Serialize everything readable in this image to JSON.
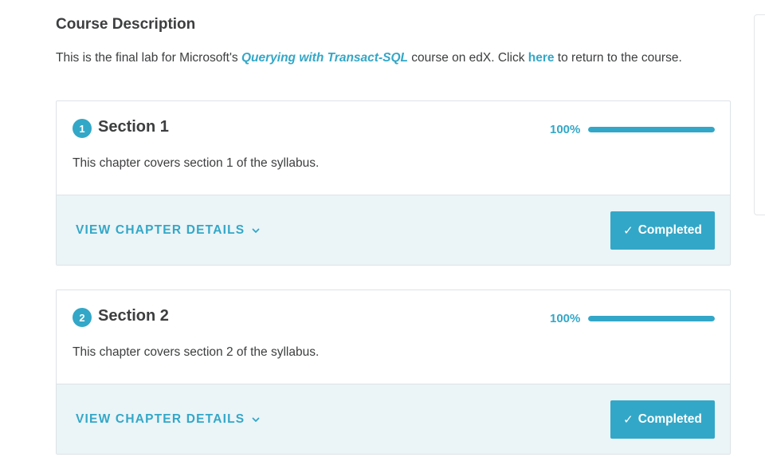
{
  "description": {
    "title": "Course Description",
    "text_before": "This is the final lab for Microsoft's ",
    "course_link": "Querying with Transact-SQL",
    "text_middle": " course on edX. Click ",
    "here_link": "here",
    "text_after": " to return to the course."
  },
  "sections": [
    {
      "number": "1",
      "title": "Section 1",
      "progress_label": "100%",
      "progress": 1.0,
      "description": "This chapter covers section 1 of the syllabus.",
      "details_label": "VIEW CHAPTER DETAILS",
      "status_label": "Completed",
      "status_icon": "✓"
    },
    {
      "number": "2",
      "title": "Section 2",
      "progress_label": "100%",
      "progress": 1.0,
      "description": "This chapter covers section 2 of the syllabus.",
      "details_label": "VIEW CHAPTER DETAILS",
      "status_label": "Completed",
      "status_icon": "✓"
    }
  ],
  "colors": {
    "accent": "#33a7c7",
    "card_footer": "#ebf4f7",
    "text": "#3d3e3f"
  }
}
